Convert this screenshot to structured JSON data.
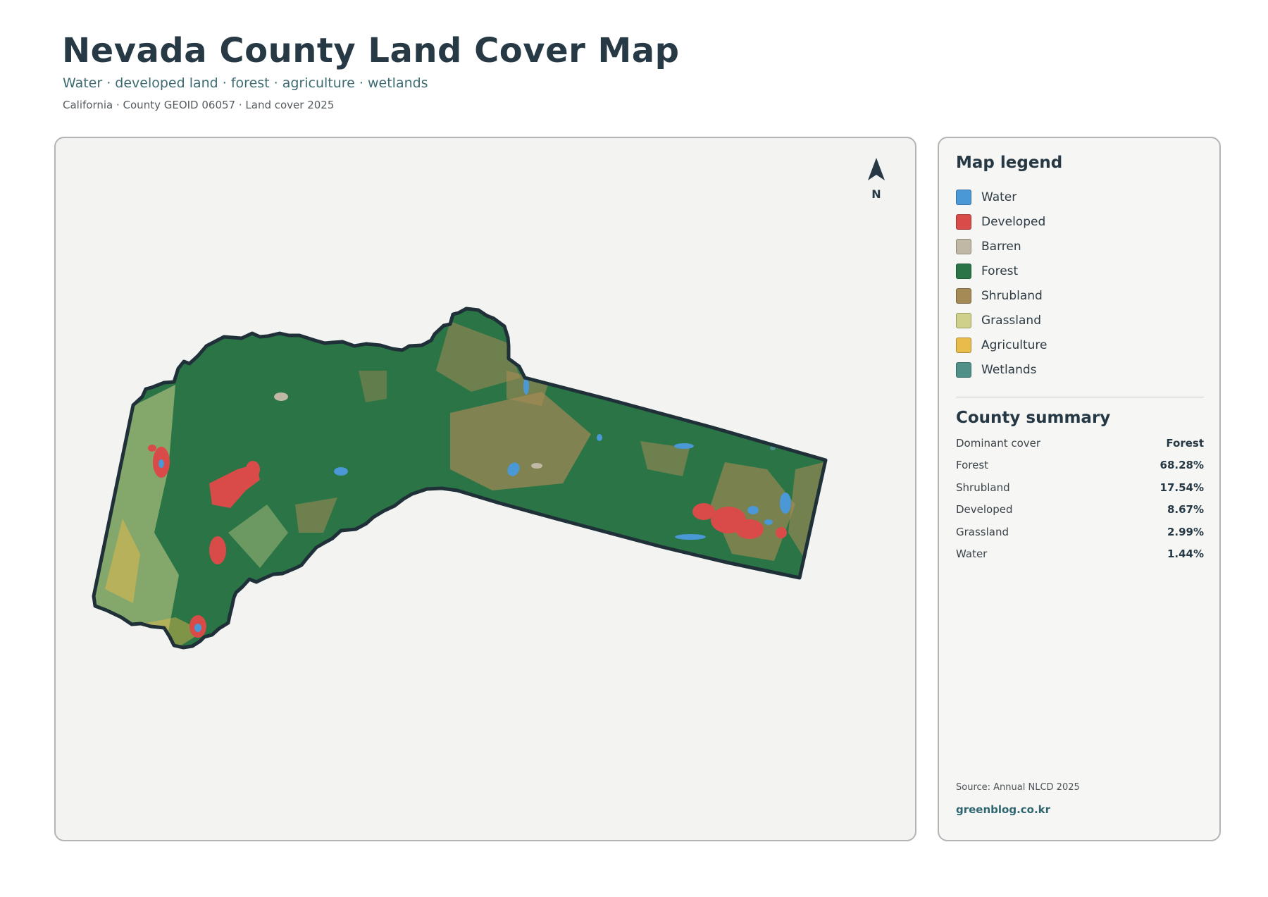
{
  "header": {
    "title": "Nevada County Land Cover Map",
    "subtitle": "Water · developed land · forest · agriculture · wetlands",
    "meta": "California · County GEOID 06057 · Land cover 2025"
  },
  "map": {
    "north_label": "N"
  },
  "legend": {
    "heading": "Map legend",
    "items": [
      {
        "label": "Water",
        "color": "#4a98d6"
      },
      {
        "label": "Developed",
        "color": "#d94b48"
      },
      {
        "label": "Barren",
        "color": "#c0b8a4"
      },
      {
        "label": "Forest",
        "color": "#2a7446"
      },
      {
        "label": "Shrubland",
        "color": "#a58a55"
      },
      {
        "label": "Grassland",
        "color": "#cdd18a"
      },
      {
        "label": "Agriculture",
        "color": "#e8bc4a"
      },
      {
        "label": "Wetlands",
        "color": "#4f9188"
      }
    ]
  },
  "summary": {
    "heading": "County summary",
    "rows": [
      {
        "label": "Dominant cover",
        "value": "Forest"
      },
      {
        "label": "Forest",
        "value": "68.28%"
      },
      {
        "label": "Shrubland",
        "value": "17.54%"
      },
      {
        "label": "Developed",
        "value": "8.67%"
      },
      {
        "label": "Grassland",
        "value": "2.99%"
      },
      {
        "label": "Water",
        "value": "1.44%"
      }
    ]
  },
  "footer": {
    "source": "Source: Annual NLCD 2025",
    "brand": "greenblog.co.kr"
  }
}
